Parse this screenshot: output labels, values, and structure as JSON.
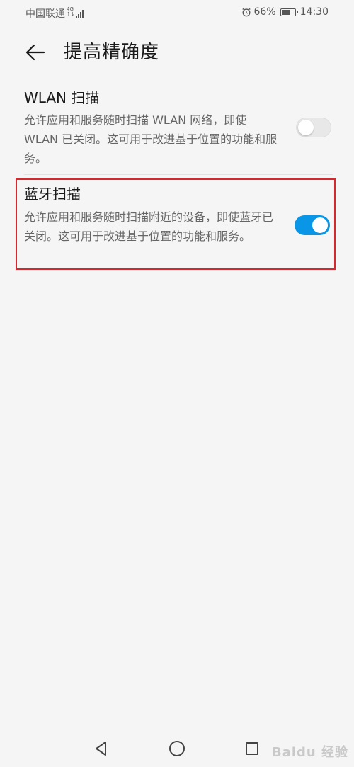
{
  "status_bar": {
    "carrier": "中国联通",
    "network_type_top": "4G",
    "network_type_bottom": "↑↓",
    "battery_percent_text": "66%",
    "battery_level": 0.66,
    "time": "14:30",
    "icons": [
      "signal-icon",
      "alarm-icon",
      "battery-icon"
    ]
  },
  "header": {
    "back_icon": "back-arrow-icon",
    "title": "提高精确度"
  },
  "settings": [
    {
      "title": "WLAN 扫描",
      "description": "允许应用和服务随时扫描 WLAN 网络，即使 WLAN 已关闭。这可用于改进基于位置的功能和服务。",
      "enabled": false
    },
    {
      "title": "蓝牙扫描",
      "description": "允许应用和服务随时扫描附近的设备，即使蓝牙已关闭。这可用于改进基于位置的功能和服务。",
      "enabled": true,
      "highlighted": true
    }
  ],
  "colors": {
    "accent": "#0a96e6",
    "highlight_border": "#d7262c",
    "background": "#f5f5f5"
  },
  "nav_bar": {
    "icons": [
      "nav-back-icon",
      "nav-home-icon",
      "nav-recent-icon"
    ]
  },
  "watermark": "Baidu 经验"
}
